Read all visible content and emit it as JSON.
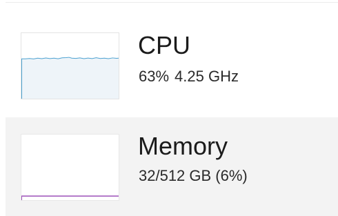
{
  "items": [
    {
      "title": "CPU",
      "utilization": "63%",
      "speed": "4.25 GHz",
      "graph_color": "#4aa0d0",
      "graph_fill": "#eef4f9"
    },
    {
      "title": "Memory",
      "usage": "32/512 GB (6%)",
      "graph_color": "#9c4fb8"
    }
  ]
}
